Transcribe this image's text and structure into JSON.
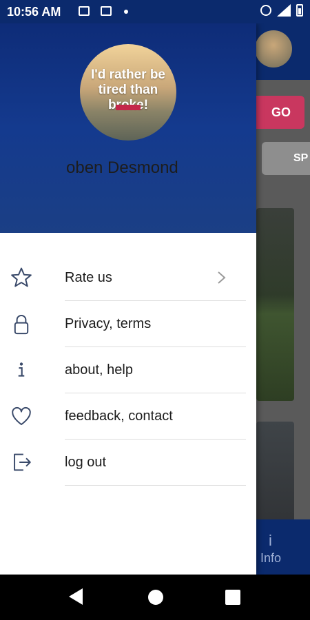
{
  "status_bar": {
    "time": "10:56 AM"
  },
  "background_app": {
    "go_label": "GO",
    "sp_label": "SP",
    "info_icon": "i",
    "info_label": "Info"
  },
  "drawer": {
    "profile": {
      "photo_quote": "I'd rather be tired than broke!",
      "name": "oben Desmond"
    },
    "menu": [
      {
        "label": "Rate us",
        "icon": "star-icon",
        "has_chevron": true
      },
      {
        "label": "Privacy, terms",
        "icon": "lock-icon"
      },
      {
        "label": "about, help",
        "icon": "info-icon"
      },
      {
        "label": "feedback, contact",
        "icon": "heart-icon"
      },
      {
        "label": "log out",
        "icon": "logout-icon"
      }
    ]
  }
}
